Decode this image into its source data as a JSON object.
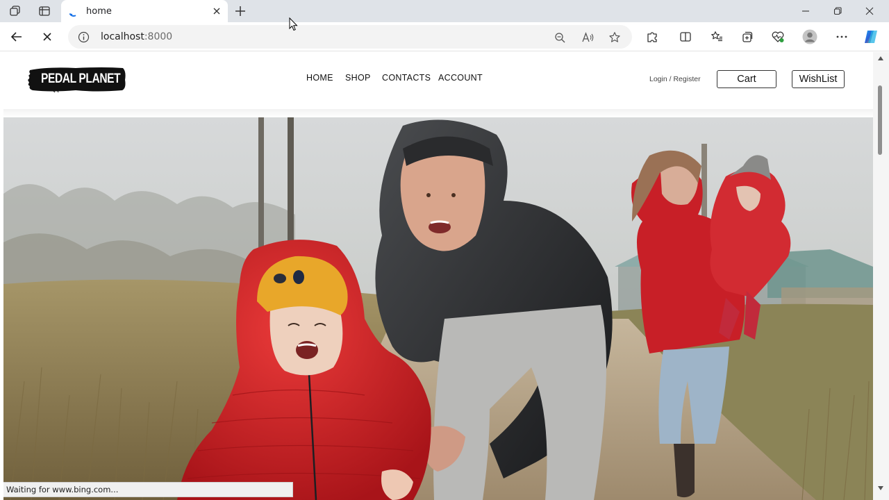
{
  "browser": {
    "tab": {
      "title": "home"
    },
    "address": {
      "host": "localhost",
      "port": ":8000"
    },
    "status_text": "Waiting for www.bing.com..."
  },
  "site": {
    "logo_text": "PEDAL PLANET",
    "nav": [
      "HOME",
      "SHOP",
      "CONTACTS",
      "ACCOUNT"
    ],
    "login": "Login",
    "slash": "/",
    "register": "Register",
    "cart_label": "Cart",
    "wishlist_label": "WishList"
  },
  "colors": {
    "accent_edge": "#1e90ff",
    "jacket_red": "#d6242b",
    "beanie_yellow": "#e8a72a"
  }
}
